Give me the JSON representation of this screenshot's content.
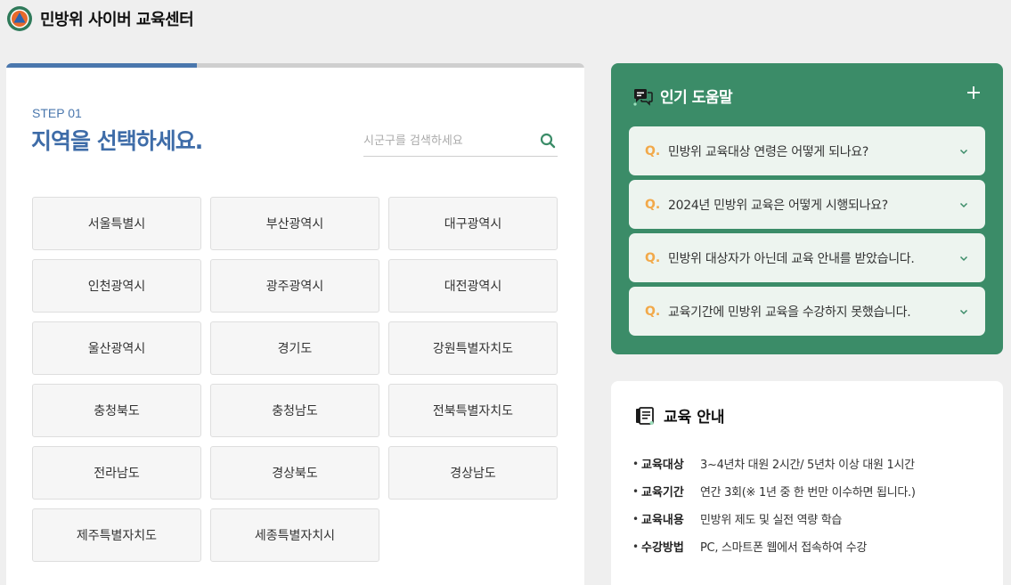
{
  "header": {
    "title": "민방위 사이버 교육센터",
    "logo_icon": "civil-defense-logo"
  },
  "colors": {
    "accent_blue": "#4a77ad",
    "help_green": "#3b8c68",
    "faq_q_orange": "#f2a94a"
  },
  "region_step": {
    "progress": 0.33,
    "step_label": "STEP 01",
    "title": "지역을 선택하세요.",
    "search": {
      "placeholder": "시군구를 검색하세요",
      "value": "",
      "icon": "search-icon"
    },
    "regions": [
      "서울특별시",
      "부산광역시",
      "대구광역시",
      "인천광역시",
      "광주광역시",
      "대전광역시",
      "울산광역시",
      "경기도",
      "강원특별자치도",
      "충청북도",
      "충청남도",
      "전북특별자치도",
      "전라남도",
      "경상북도",
      "경상남도",
      "제주특별자치도",
      "세종특별자치시"
    ]
  },
  "popular_help": {
    "title": "인기 도움말",
    "icon": "chat-bubbles-icon",
    "more_icon": "plus-icon",
    "q_marker": "Q.",
    "items": [
      "민방위 교육대상 연령은 어떻게 되나요?",
      "2024년 민방위 교육은 어떻게 시행되나요?",
      "민방위 대상자가 아닌데 교육 안내를 받았습니다.",
      "교육기간에 민방위 교육을 수강하지 못했습니다."
    ]
  },
  "education_info": {
    "title": "교육 안내",
    "icon": "document-icon",
    "bullet": "•",
    "rows": [
      {
        "label": "교육대상",
        "value": "3~4년차 대원 2시간/ 5년차 이상 대원 1시간"
      },
      {
        "label": "교육기간",
        "value": "연간 3회(※ 1년 중 한 번만 이수하면 됩니다.)"
      },
      {
        "label": "교육내용",
        "value": "민방위 제도 및 실전 역량 학습"
      },
      {
        "label": "수강방법",
        "value": "PC, 스마트폰 웹에서 접속하여 수강"
      }
    ]
  }
}
